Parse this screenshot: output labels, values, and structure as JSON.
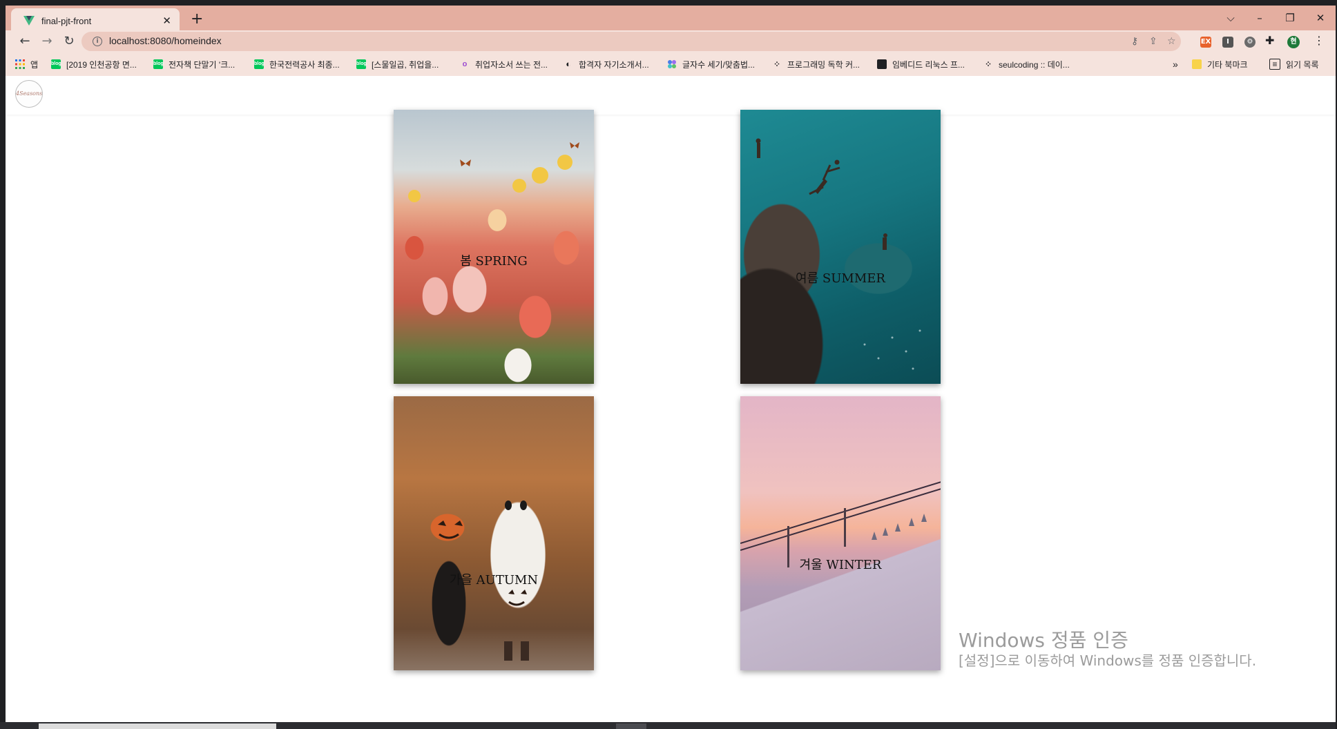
{
  "browser": {
    "tab": {
      "title": "final-pjt-front",
      "favicon": "vue-logo-icon",
      "favicon_color": "#41b883"
    },
    "new_tab": "+",
    "window_controls": {
      "tab_search": "⌵",
      "minimize": "–",
      "restore": "❐",
      "close": "✕"
    },
    "url": "localhost:8080/homeindex",
    "profile_initial": "현",
    "extensions": [
      {
        "name": "ext-ex-icon",
        "label": "EX",
        "color": "#e8622c"
      },
      {
        "name": "ext-i-icon",
        "label": "I",
        "color": "#555555"
      },
      {
        "name": "ext-gear-icon",
        "label": "⚙",
        "color": "#6a6a6a"
      }
    ]
  },
  "bookmarks": {
    "apps_label": "앱",
    "items": [
      {
        "label": "[2019 인천공항 면...",
        "color": "#03c75a",
        "icon": "blog"
      },
      {
        "label": "전자책 단말기 '크...",
        "color": "#03c75a",
        "icon": "blog"
      },
      {
        "label": "한국전력공사 최종...",
        "color": "#03c75a",
        "icon": "blog"
      },
      {
        "label": "[스물일곱, 취업을...",
        "color": "#03c75a",
        "icon": "blog"
      },
      {
        "label": "취업자소서 쓰는 전...",
        "color": "#9c4bd1",
        "icon": "o"
      },
      {
        "label": "합격자 자기소개서...",
        "color": "#202124",
        "icon": "◐"
      },
      {
        "label": "글자수 세기/맞춤법...",
        "color": "#4a7ce8",
        "icon": "dots"
      },
      {
        "label": "프로그래밍 독학 커...",
        "color": "#202124",
        "icon": "t"
      },
      {
        "label": "임베디드 리눅스 프...",
        "color": "#202124",
        "icon": "box"
      },
      {
        "label": "seulcoding :: 데이...",
        "color": "#202124",
        "icon": "t"
      }
    ],
    "overflow": "»",
    "other_bookmarks": "기타 북마크",
    "reading_list": "읽기 목록"
  },
  "page": {
    "logo_text": "4Seasons",
    "cards": [
      {
        "id": "spring",
        "label": "봄 SPRING"
      },
      {
        "id": "summer",
        "label": "여름 SUMMER"
      },
      {
        "id": "autumn",
        "label": "가을 AUTUMN"
      },
      {
        "id": "winter",
        "label": "겨울 WINTER"
      }
    ]
  },
  "watermark": {
    "title": "Windows 정품 인증",
    "subtitle": "[설정]으로 이동하여 Windows를 정품 인증합니다."
  }
}
